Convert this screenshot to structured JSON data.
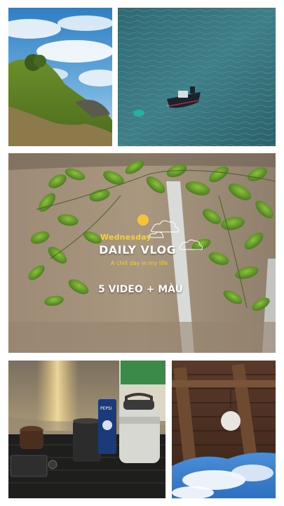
{
  "collage": {
    "tiles": [
      {
        "icon": "cliff-sky-photo"
      },
      {
        "icon": "sea-boat-photo"
      },
      {
        "icon": "wall-leaves-photo"
      },
      {
        "icon": "table-drinks-photo"
      },
      {
        "icon": "roof-sky-photo"
      }
    ]
  },
  "overlay": {
    "weekday": "Wednesday",
    "title": "DAILY VLOG",
    "subtitle": "A chill day in my life",
    "headline": "5 VIDEO + MÀU",
    "accent_color": "#f2d23a",
    "sun_color": "#f6c23c"
  },
  "cups": {
    "can_label": "PEPSI"
  }
}
